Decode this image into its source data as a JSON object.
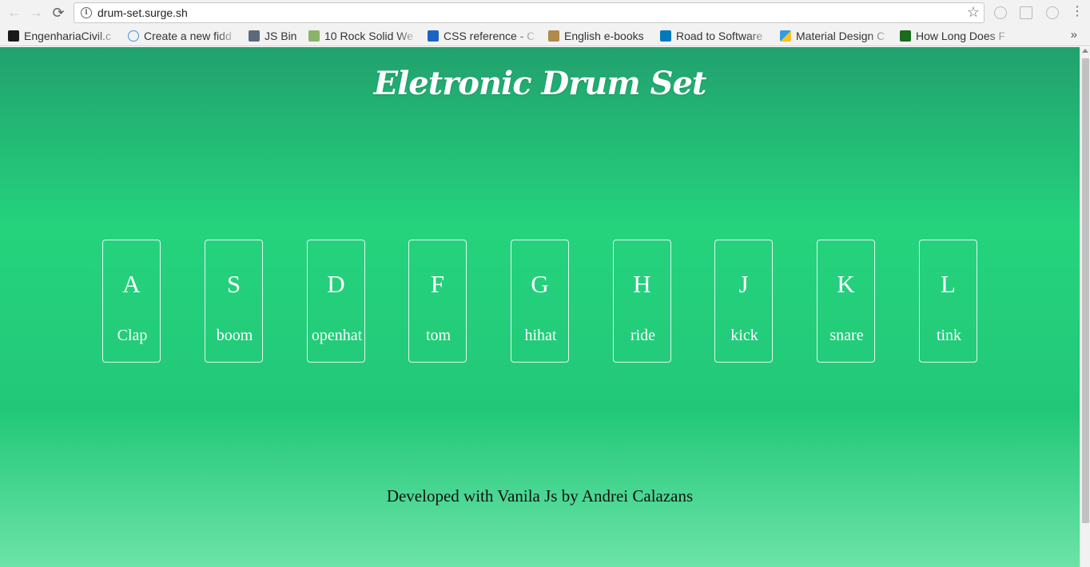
{
  "browser": {
    "url": "drum-set.surge.sh",
    "back_glyph": "←",
    "forward_glyph": "→",
    "reload_glyph": "⟳",
    "info_glyph": "i",
    "star_glyph": "☆",
    "menu_glyph": "⋮",
    "more_glyph": "»",
    "bookmarks": [
      {
        "label": "EngenhariaCivil.c",
        "icon": "ec-logo-icon",
        "color": "#1a1a1a"
      },
      {
        "label": "Create a new fidd",
        "icon": "cloud-icon",
        "color": "#4a90d9"
      },
      {
        "label": "JS Bin",
        "icon": "jsbin-icon",
        "color": "#5b6b7c"
      },
      {
        "label": "10 Rock Solid We",
        "icon": "d-icon",
        "color": "#8cb36b"
      },
      {
        "label": "CSS reference - C",
        "icon": "css-icon",
        "color": "#1c64c4"
      },
      {
        "label": "English e-books",
        "icon": "book-icon",
        "color": "#b08a4a"
      },
      {
        "label": "Road to Software",
        "icon": "trello-icon",
        "color": "#0079bf"
      },
      {
        "label": "Material Design C",
        "icon": "material-icon",
        "color": "#2e9de4"
      },
      {
        "label": "How Long Does F",
        "icon": "bracket-a-icon",
        "color": "#1a6b1a"
      }
    ]
  },
  "page": {
    "title": "Eletronic Drum Set",
    "keys": [
      {
        "letter": "A",
        "sound": "Clap"
      },
      {
        "letter": "S",
        "sound": "boom"
      },
      {
        "letter": "D",
        "sound": "openhat"
      },
      {
        "letter": "F",
        "sound": "tom"
      },
      {
        "letter": "G",
        "sound": "hihat"
      },
      {
        "letter": "H",
        "sound": "ride"
      },
      {
        "letter": "J",
        "sound": "kick"
      },
      {
        "letter": "K",
        "sound": "snare"
      },
      {
        "letter": "L",
        "sound": "tink"
      }
    ],
    "footer": "Developed with Vanila Js by Andrei Calazans"
  }
}
